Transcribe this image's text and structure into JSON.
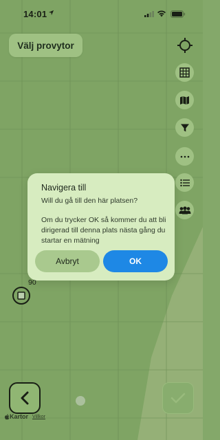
{
  "status_bar": {
    "time": "14:01"
  },
  "toolbar": {
    "choose_samples_label": "Välj provytor"
  },
  "side_buttons": [
    {
      "icon": "crosshair-icon"
    },
    {
      "icon": "grid-icon"
    },
    {
      "icon": "map-icon"
    },
    {
      "icon": "filter-icon"
    },
    {
      "icon": "more-icon"
    },
    {
      "icon": "list-icon"
    },
    {
      "icon": "people-icon"
    }
  ],
  "dialog": {
    "title": "Navigera till",
    "subtitle": "Will du gå till den här platsen?",
    "body": "Om du trycker OK så kommer du att bli dirigerad till denna plats nästa gång du startar en mätning",
    "cancel_label": "Avbryt",
    "ok_label": "OK"
  },
  "map": {
    "marker_label": "90",
    "attribution_maps": "Kartor",
    "attribution_terms": "Villkor"
  },
  "colors": {
    "map_green": "#84a86a",
    "button_green": "#a9c98e",
    "dialog_bg": "#d7ecc0",
    "ok_blue": "#1e88e5"
  }
}
